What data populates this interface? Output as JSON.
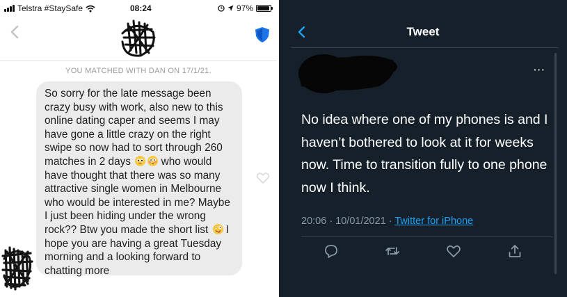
{
  "left": {
    "status": {
      "carrier": "Telstra #StaySafe",
      "time": "08:24",
      "battery": "97%",
      "battery_level": 0.97
    },
    "matched_text": "YOU MATCHED WITH DAN ON 17/1/21.",
    "message": {
      "part1": "So sorry for the late message been crazy busy with work, also new to this online dating caper and seems I may have gone a little crazy on the right swipe so now had to sort through 260 matches in 2 days",
      "part2": " who would have thought that there was so many attractive single women in Melbourne who would be interested in me? Maybe I just been hiding under the wrong rock?? Btw you made the short list",
      "part3": " I hope you are having a great Tuesday morning and a looking forward to chatting more"
    }
  },
  "right": {
    "header_title": "Tweet",
    "more": "···",
    "tweet_text": "No idea where one of my phones is and I haven’t bothered to look at it for weeks now. Time to transition fully to one phone now I think.",
    "timestamp": "20:06 · 10/01/2021 · ",
    "source": "Twitter for iPhone"
  },
  "colors": {
    "twitter_bg": "#15202b",
    "twitter_link": "#1da1f2",
    "shield_blue": "#1a73e8",
    "bubble_gray": "#ebebeb"
  }
}
